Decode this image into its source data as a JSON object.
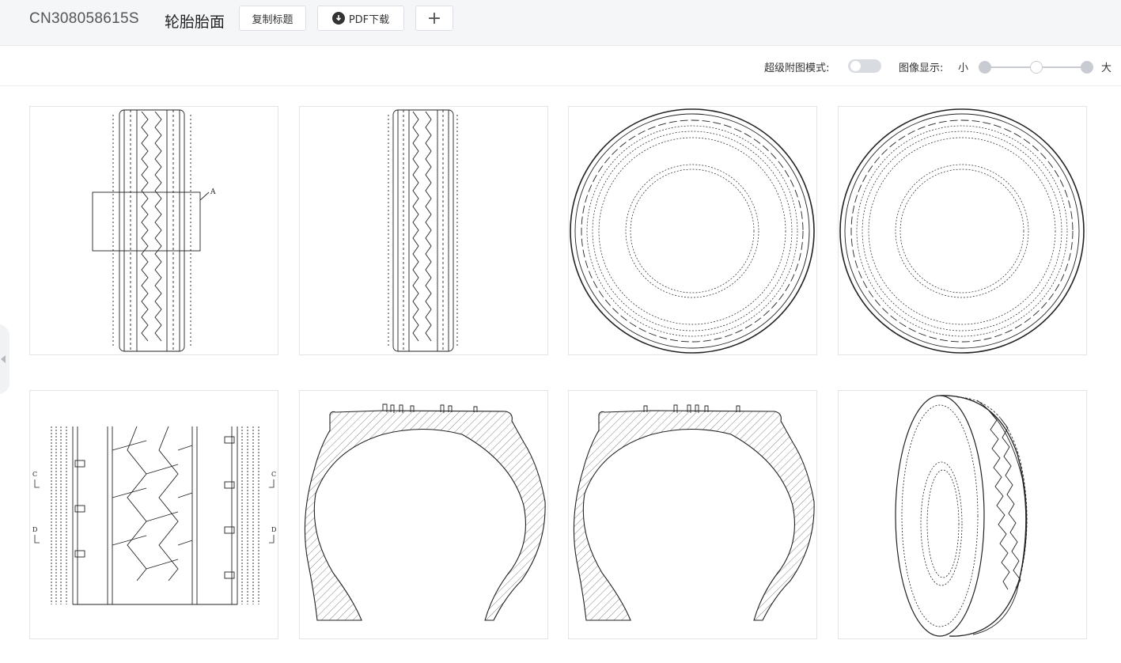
{
  "header": {
    "patent_number": "CN308058615S",
    "title": "轮胎胎面",
    "copy_title_label": "复制标题",
    "pdf_download_label": "PDF下载",
    "add_label": "+"
  },
  "toolbar": {
    "super_figure_mode_label": "超级附图模式:",
    "super_figure_mode_on": false,
    "image_display_label": "图像显示:",
    "size_small_label": "小",
    "size_large_label": "大",
    "image_size_level": 0.5
  },
  "figures": [
    {
      "name": "front-view",
      "callout_label": "A"
    },
    {
      "name": "rear-view"
    },
    {
      "name": "left-side-view"
    },
    {
      "name": "right-side-view"
    },
    {
      "name": "tread-pattern-detail",
      "section_labels": [
        "C",
        "D",
        "C",
        "D"
      ]
    },
    {
      "name": "cross-section-c"
    },
    {
      "name": "cross-section-d"
    },
    {
      "name": "perspective-view"
    }
  ]
}
